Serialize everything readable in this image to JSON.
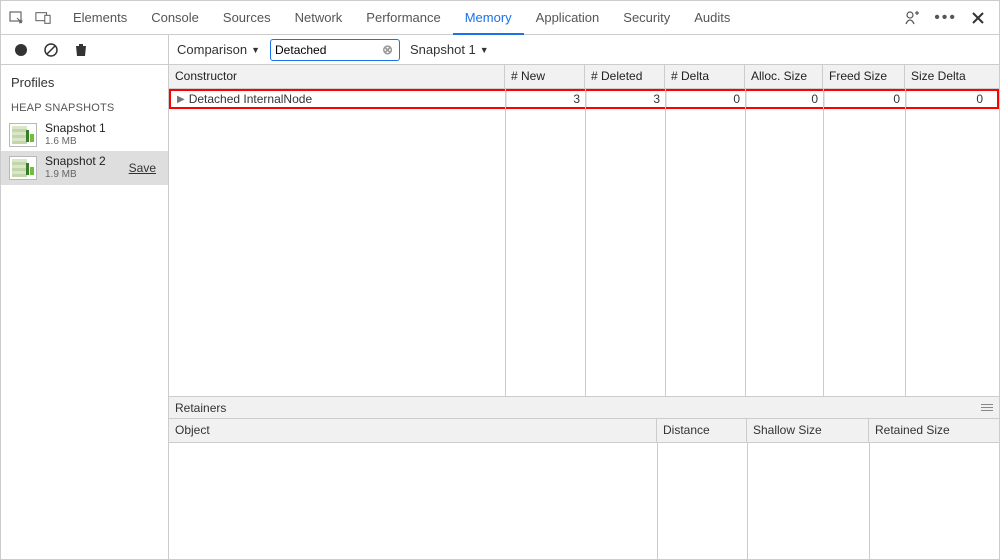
{
  "tabs": [
    "Elements",
    "Console",
    "Sources",
    "Network",
    "Performance",
    "Memory",
    "Application",
    "Security",
    "Audits"
  ],
  "active_tab_index": 5,
  "sidebar": {
    "title": "Profiles",
    "section_label": "HEAP SNAPSHOTS",
    "snapshots": [
      {
        "title": "Snapshot 1",
        "size": "1.6 MB",
        "selected": false,
        "save": false
      },
      {
        "title": "Snapshot 2",
        "size": "1.9 MB",
        "selected": true,
        "save": true
      }
    ],
    "save_label": "Save"
  },
  "toolbar": {
    "view_label": "Comparison",
    "filter_value": "Detached",
    "base_label": "Snapshot 1"
  },
  "heap": {
    "columns": [
      "Constructor",
      "# New",
      "# Deleted",
      "# Delta",
      "Alloc. Size",
      "Freed Size",
      "Size Delta"
    ],
    "rows": [
      {
        "ctor": "Detached InternalNode",
        "new": "3",
        "deleted": "3",
        "delta": "0",
        "alloc": "0",
        "freed": "0",
        "size_delta": "0",
        "highlight": true
      }
    ]
  },
  "retainers": {
    "title": "Retainers",
    "columns": [
      "Object",
      "Distance",
      "Shallow Size",
      "Retained Size"
    ]
  }
}
